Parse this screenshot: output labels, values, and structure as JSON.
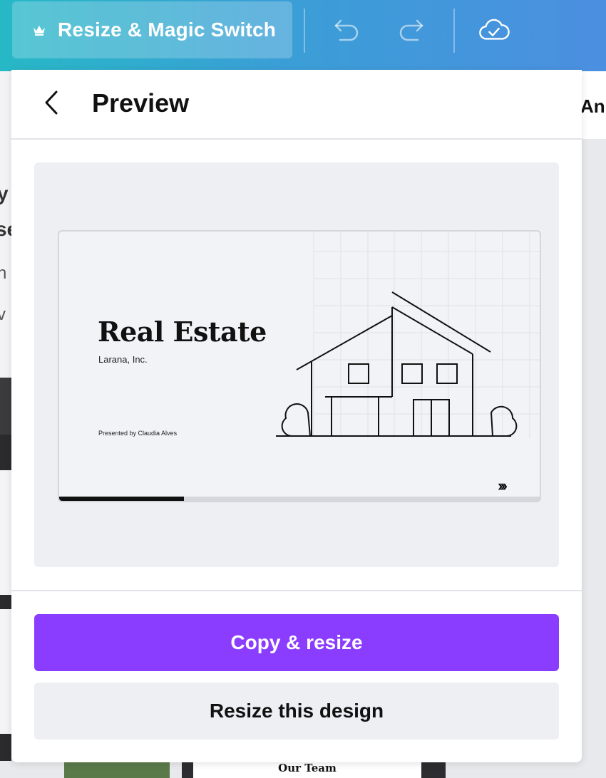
{
  "toolbar": {
    "resize_label": "Resize & Magic Switch",
    "resize_icon": "crown-icon",
    "undo_icon": "undo-icon",
    "redo_icon": "redo-icon",
    "save_status_icon": "cloud-check-icon"
  },
  "background": {
    "tab_fragment": "Ani",
    "left_fragments": [
      "y",
      "se",
      "n",
      "v"
    ],
    "bottom_thumb_title": "Our Team"
  },
  "panel": {
    "back_icon": "chevron-left-icon",
    "title": "Preview",
    "preview": {
      "slide_title": "Real Estate",
      "company": "Larana, Inc.",
      "presenter": "Presented by Claudia Alves",
      "nav_glyph": "›››",
      "progress": 0.26
    },
    "primary_action": "Copy & resize",
    "secondary_action": "Resize this design"
  },
  "colors": {
    "primary": "#8b3dff",
    "toolbar_start": "#27b8c6",
    "toolbar_end": "#4b8fe0"
  }
}
